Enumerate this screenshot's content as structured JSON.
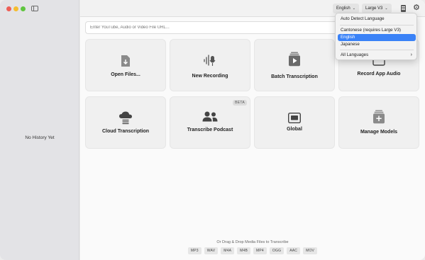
{
  "sidebar": {
    "empty_text": "No History Yet"
  },
  "toolbar": {
    "language_label": "English",
    "model_label": "Large V3"
  },
  "url_input": {
    "placeholder": "Enter YouTube, Audio or Video File URL..."
  },
  "cards": {
    "open_files": "Open Files...",
    "new_recording": "New Recording",
    "batch_transcription": "Batch Transcription",
    "record_app_audio": "Record App Audio",
    "cloud_transcription": "Cloud Transcription",
    "transcribe_podcast": "Transcribe Podcast",
    "transcribe_podcast_badge": "BETA",
    "global": "Global",
    "manage_models": "Manage Models"
  },
  "footer": {
    "drag_drop_text": "Or Drag & Drop Media Files to Transcribe",
    "formats": [
      "MP3",
      "WAV",
      "M4A",
      "M4B",
      "MP4",
      "OGG",
      "AAC",
      "MOV"
    ]
  },
  "language_menu": {
    "auto_detect": "Auto Detect Language",
    "cantonese": "Cantonese (requires Large V3)",
    "english": "English",
    "japanese": "Japanese",
    "all_languages": "All Languages",
    "selected_color": "#3a82f7"
  }
}
